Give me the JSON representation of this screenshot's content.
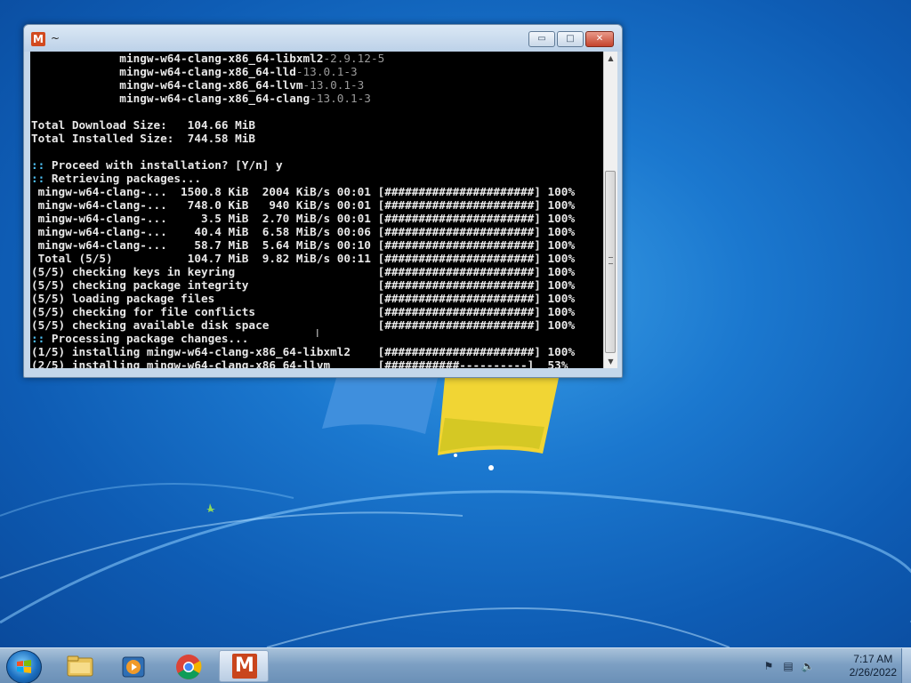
{
  "window": {
    "title": "~",
    "app_icon_letter": "M",
    "buttons": {
      "minimize": "▭",
      "maximize": "□",
      "close": "✕"
    }
  },
  "terminal": {
    "lines": [
      {
        "text": "             mingw-w64-clang-x86_64-libxml2",
        "dim": "-2.9.12-5"
      },
      {
        "text": "             mingw-w64-clang-x86_64-lld",
        "dim": "-13.0.1-3"
      },
      {
        "text": "             mingw-w64-clang-x86_64-llvm",
        "dim": "-13.0.1-3"
      },
      {
        "text": "             mingw-w64-clang-x86_64-clang",
        "dim": "-13.0.1-3"
      },
      {
        "text": "",
        "dim": ""
      },
      {
        "text": "Total Download Size:   104.66 MiB",
        "dim": ""
      },
      {
        "text": "Total Installed Size:  744.58 MiB",
        "dim": ""
      },
      {
        "text": "",
        "dim": ""
      },
      {
        "prefix": "::",
        "text": " Proceed with installation? [Y/n] y",
        "dim": ""
      },
      {
        "prefix": "::",
        "text": " Retrieving packages...",
        "dim": ""
      },
      {
        "text": " mingw-w64-clang-...  1500.8 KiB  2004 KiB/s 00:01 [######################] 100%",
        "dim": ""
      },
      {
        "text": " mingw-w64-clang-...   748.0 KiB   940 KiB/s 00:01 [######################] 100%",
        "dim": ""
      },
      {
        "text": " mingw-w64-clang-...     3.5 MiB  2.70 MiB/s 00:01 [######################] 100%",
        "dim": ""
      },
      {
        "text": " mingw-w64-clang-...    40.4 MiB  6.58 MiB/s 00:06 [######################] 100%",
        "dim": ""
      },
      {
        "text": " mingw-w64-clang-...    58.7 MiB  5.64 MiB/s 00:10 [######################] 100%",
        "dim": ""
      },
      {
        "text": " Total (5/5)           104.7 MiB  9.82 MiB/s 00:11 [######################] 100%",
        "dim": ""
      },
      {
        "text": "(5/5) checking keys in keyring                     [######################] 100%",
        "dim": ""
      },
      {
        "text": "(5/5) checking package integrity                   [######################] 100%",
        "dim": ""
      },
      {
        "text": "(5/5) loading package files                        [######################] 100%",
        "dim": ""
      },
      {
        "text": "(5/5) checking for file conflicts                  [######################] 100%",
        "dim": ""
      },
      {
        "text": "(5/5) checking available disk space                [######################] 100%",
        "dim": ""
      },
      {
        "prefix": "::",
        "text": " Processing package changes...",
        "dim": ""
      },
      {
        "text": "(1/5) installing mingw-w64-clang-x86_64-libxml2    [######################] 100%",
        "dim": ""
      },
      {
        "text": "(2/5) installing mingw-w64-clang-x86_64-llvm       [###########----------]  53%",
        "dim": ""
      }
    ]
  },
  "taskbar": {
    "items": [
      "explorer-icon",
      "media-player-icon",
      "chrome-icon",
      "msys2-icon"
    ],
    "active_item": "msys2-icon",
    "msys_letter": "M",
    "clock": {
      "time": "7:17 AM",
      "date": "2/26/2022"
    }
  },
  "colors": {
    "terminal_bg": "#000000",
    "terminal_fg": "#e8e8e8",
    "prompt_prefix": "#4fc3f7",
    "desktop": "#1b78cf"
  }
}
